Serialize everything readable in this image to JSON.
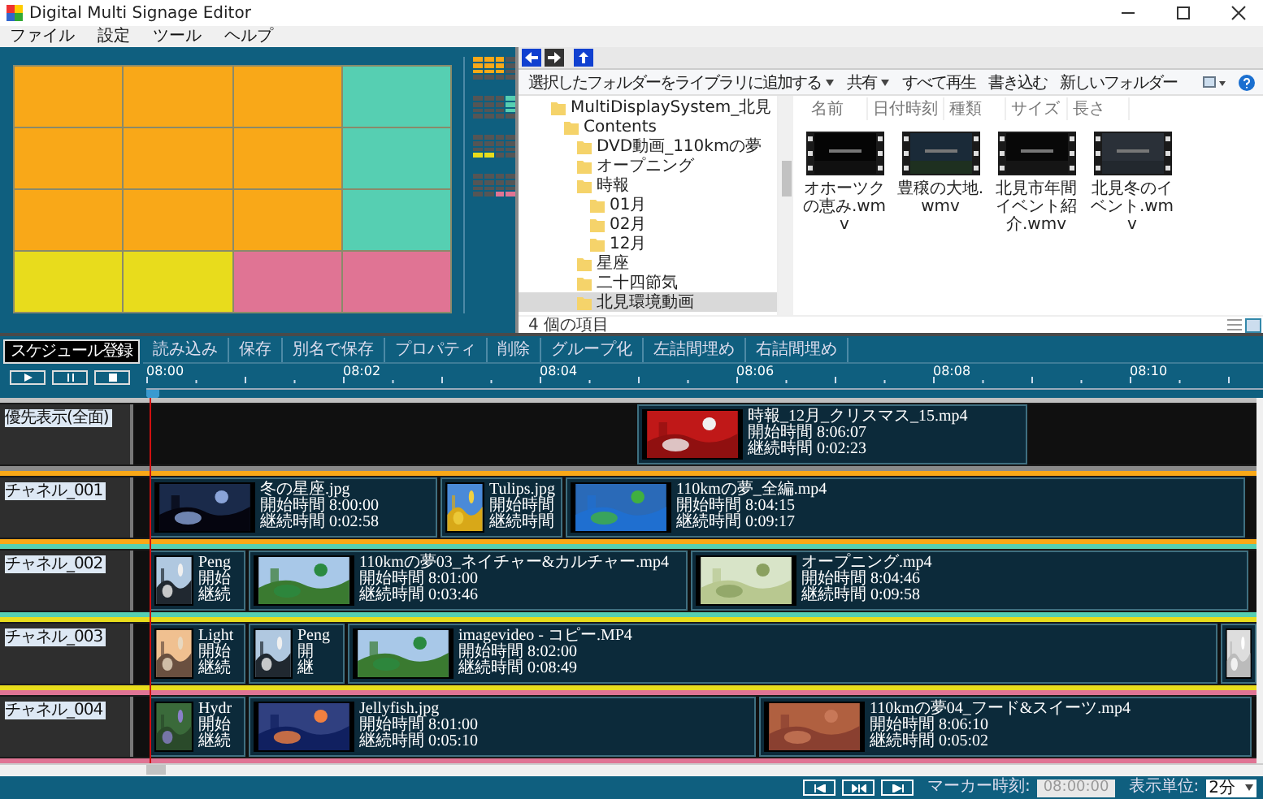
{
  "window": {
    "title": "Digital Multi Signage Editor"
  },
  "menu": [
    "ファイル",
    "設定",
    "ツール",
    "ヘルプ"
  ],
  "layout": {
    "cells": [
      {
        "color": "#f9a818"
      },
      {
        "color": "#f9a818"
      },
      {
        "color": "#f9a818"
      },
      {
        "color": "#56cfb2"
      },
      {
        "color": "#f9a818"
      },
      {
        "color": "#f9a818"
      },
      {
        "color": "#f9a818"
      },
      {
        "color": "#56cfb2"
      },
      {
        "color": "#f9a818"
      },
      {
        "color": "#f9a818"
      },
      {
        "color": "#f9a818"
      },
      {
        "color": "#56cfb2"
      },
      {
        "color": "#e8dc1c"
      },
      {
        "color": "#e8dc1c"
      },
      {
        "color": "#e07494"
      },
      {
        "color": "#e07494"
      }
    ]
  },
  "explorer": {
    "toolbar": [
      {
        "label": "選択したフォルダーをライブラリに追加する",
        "dropdown": true
      },
      {
        "label": "共有",
        "dropdown": true
      },
      {
        "label": "すべて再生",
        "dropdown": false
      },
      {
        "label": "書き込む",
        "dropdown": false
      },
      {
        "label": "新しいフォルダー",
        "dropdown": false
      }
    ],
    "tree": [
      {
        "label": "MultiDisplaySystem_北見",
        "selected": false,
        "children": [
          {
            "label": "Contents",
            "selected": false,
            "children": [
              {
                "label": "DVD動画_110kmの夢",
                "selected": false
              },
              {
                "label": "オープニング",
                "selected": false
              },
              {
                "label": "時報",
                "selected": false,
                "children": [
                  {
                    "label": "01月",
                    "selected": false
                  },
                  {
                    "label": "02月",
                    "selected": false
                  },
                  {
                    "label": "12月",
                    "selected": false
                  }
                ]
              },
              {
                "label": "星座",
                "selected": false
              },
              {
                "label": "二十四節気",
                "selected": false
              },
              {
                "label": "北見環境動画",
                "selected": true
              }
            ]
          }
        ]
      }
    ],
    "columns": [
      "名前",
      "日付時刻",
      "種類",
      "サイズ",
      "長さ"
    ],
    "files": [
      {
        "name": "オホーツクの恵み.wmv"
      },
      {
        "name": "豊穣の大地.wmv"
      },
      {
        "name": "北見市年間イベント紹介.wmv"
      },
      {
        "name": "北見冬のイベント.wmv"
      }
    ],
    "status": "4 個の項目"
  },
  "timeline": {
    "register_button": "スケジュール登録",
    "toolbar": [
      "読み込み",
      "保存",
      "別名で保存",
      "プロパティ",
      "削除",
      "グループ化",
      "左詰間埋め",
      "右詰間埋め"
    ],
    "ruler": [
      "08:00",
      "08:02",
      "08:04",
      "08:06",
      "08:08",
      "08:10"
    ],
    "tracks": [
      {
        "label": "優先表示(全面)",
        "color": "#8a8a8a",
        "clips": [
          {
            "lines": [
              "時報_12月_クリスマス_15.mp4",
              "開始時間 8:06:07",
              "継続時間 0:02:23"
            ]
          }
        ]
      },
      {
        "label": "チャネル_001",
        "color": "#f9a818",
        "clips": [
          {
            "lines": [
              "冬の星座.jpg",
              "開始時間 8:00:00",
              "継続時間 0:02:58"
            ]
          },
          {
            "lines": [
              "Tulips.jpg",
              "開始時間",
              "継続時間"
            ]
          },
          {
            "lines": [
              "110kmの夢_全編.mp4",
              "開始時間 8:04:15",
              "継続時間 0:09:17"
            ]
          }
        ]
      },
      {
        "label": "チャネル_002",
        "color": "#56cfb2",
        "clips": [
          {
            "lines": [
              "Peng",
              "開始",
              "継続"
            ]
          },
          {
            "lines": [
              "110kmの夢03_ネイチャー&カルチャー.mp4",
              "開始時間 8:01:00",
              "継続時間 0:03:46"
            ]
          },
          {
            "lines": [
              "オープニング.mp4",
              "開始時間 8:04:46",
              "継続時間 0:09:58"
            ]
          }
        ]
      },
      {
        "label": "チャネル_003",
        "color": "#e8dc1c",
        "clips": [
          {
            "lines": [
              "Light",
              "開始",
              "継続"
            ]
          },
          {
            "lines": [
              "Peng",
              "開",
              "継"
            ]
          },
          {
            "lines": [
              "imagevideo - コピー.MP4",
              "開始時間 8:02:00",
              "継続時間 0:08:49"
            ]
          },
          {
            "kind": "picture"
          }
        ]
      },
      {
        "label": "チャネル_004",
        "color": "#e07494",
        "clips": [
          {
            "lines": [
              "Hydr",
              "開始",
              "継続"
            ]
          },
          {
            "lines": [
              "Jellyfish.jpg",
              "開始時間 8:01:00",
              "継続時間 0:05:10"
            ]
          },
          {
            "lines": [
              "110kmの夢04_フード&スイーツ.mp4",
              "開始時間 8:06:10",
              "継続時間 0:05:02"
            ]
          }
        ]
      }
    ]
  },
  "status_bar": {
    "marker_label": "マーカー時刻:",
    "marker_value": "08:00:00",
    "unit_label": "表示単位:",
    "unit_value": "2分"
  }
}
